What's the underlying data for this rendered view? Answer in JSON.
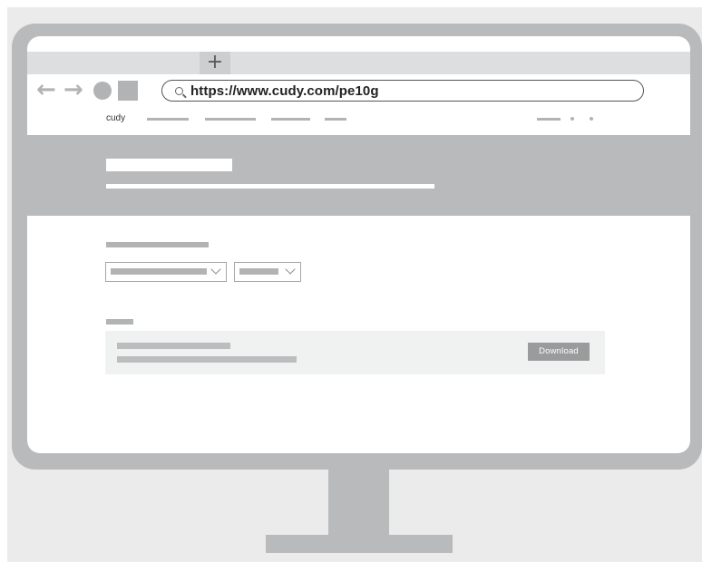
{
  "browser": {
    "new_tab_label": "+",
    "back_glyph": "←",
    "forward_glyph": "→",
    "address_url": "https://www.cudy.com/pe10g"
  },
  "site": {
    "logo_text": "cudy"
  },
  "download_item": {
    "button_label": "Download"
  },
  "icons": {
    "back": "back-arrow-icon",
    "forward": "forward-arrow-icon",
    "reload": "reload-icon",
    "home": "home-icon",
    "search": "search-icon",
    "dropdown": "chevron-down-icon"
  },
  "colors": {
    "frame": "#b9babb",
    "placeholder": "#b2b3b4",
    "button": "#9a9b9c"
  }
}
